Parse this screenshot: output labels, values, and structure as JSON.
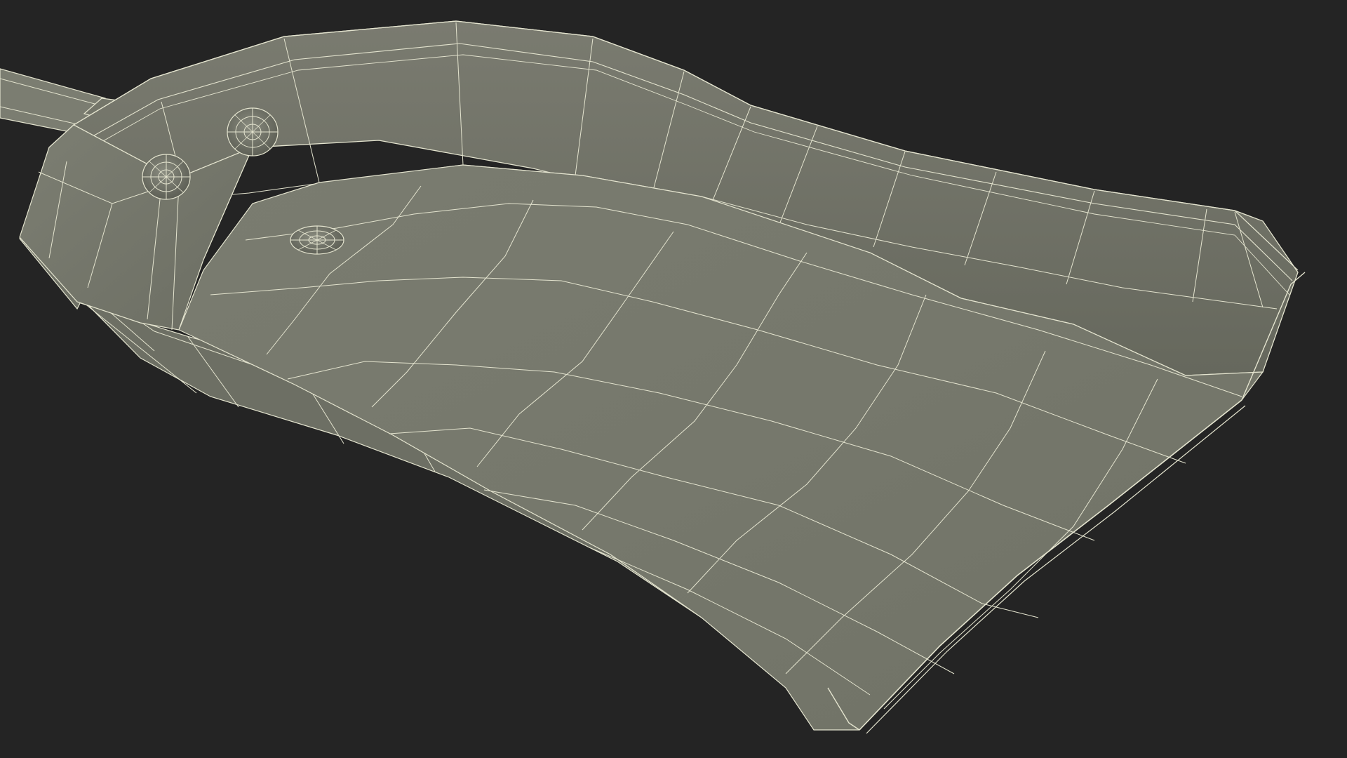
{
  "viewport": {
    "background": "#242424"
  },
  "model": {
    "name": "shovel-scoop-wireframe",
    "shading": "smooth-shaded-with-wireframe-overlay",
    "surface_color": "#74766a",
    "surface_shadow_color": "#5f6157",
    "wire_color": "#e4e4cf",
    "rivet_count": 3
  }
}
